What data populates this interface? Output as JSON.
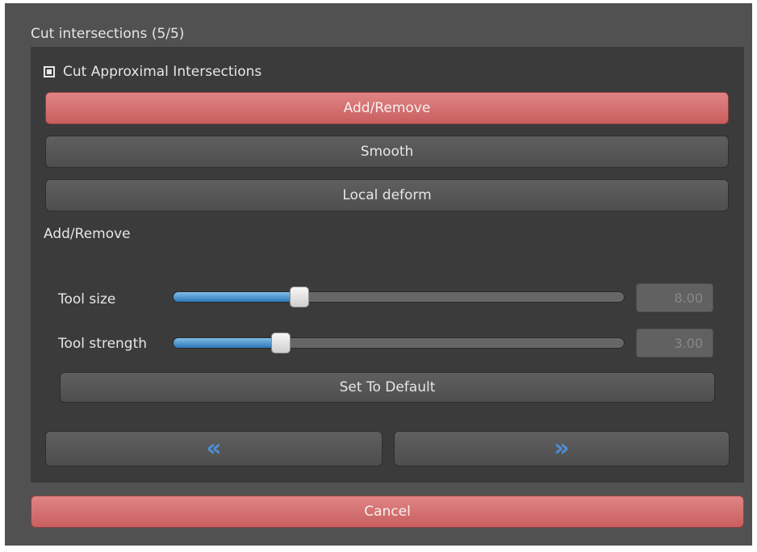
{
  "panel_title": "Cut intersections (5/5)",
  "checkbox": {
    "label": "Cut Approximal Intersections",
    "checked": true
  },
  "mode_buttons": [
    "Add/Remove",
    "Smooth",
    "Local deform"
  ],
  "active_mode": "Add/Remove",
  "section_label": "Add/Remove",
  "sliders": {
    "tool_size": {
      "label": "Tool size",
      "value": "8.00",
      "fraction": 0.28
    },
    "tool_strength": {
      "label": "Tool strength",
      "value": "3.00",
      "fraction": 0.24
    }
  },
  "set_default_label": "Set To Default",
  "nav": {
    "prev_icon": "«",
    "next_icon": "»"
  },
  "cancel_label": "Cancel",
  "colors": {
    "accent_red": "#d97070",
    "slider_blue": "#3d8bd0",
    "panel_bg": "#3b3b3b"
  }
}
